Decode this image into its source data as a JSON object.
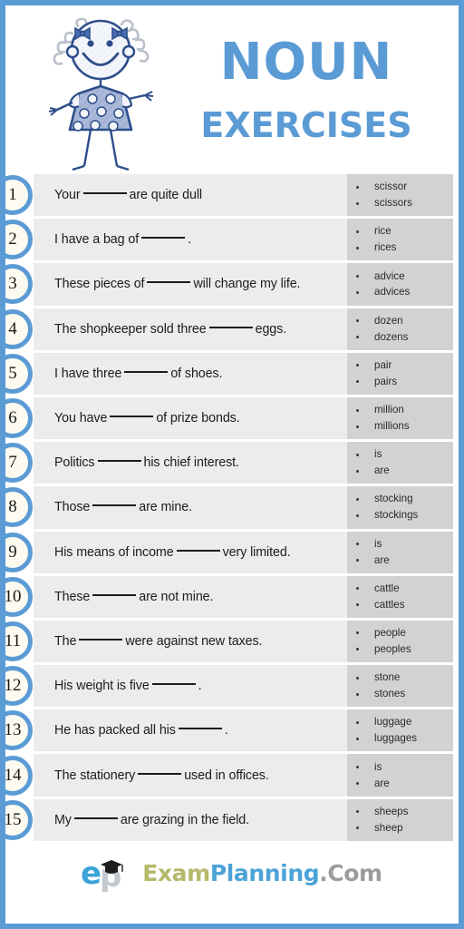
{
  "title": {
    "main": "NOUN",
    "sub": "EXERCISES"
  },
  "colors": {
    "accent_blue": "#5b9bd5",
    "border_blue": "#5b9bd5",
    "row_band": "#ececec",
    "options_box": "#d2d2d2",
    "badge_fill": "#fdfaef",
    "logo_exam": "#b5b96a",
    "logo_planning": "#4ba3d8",
    "logo_com": "#9c9c9c"
  },
  "illustration": {
    "name": "stick-figure-girl-in-polka-dot-dress"
  },
  "exercises": [
    {
      "number": "1",
      "before": "Your",
      "after": "are quite dull",
      "options": [
        "scissor",
        "scissors"
      ]
    },
    {
      "number": "2",
      "before": "I have a bag of",
      "after": ".",
      "options": [
        "rice",
        "rices"
      ]
    },
    {
      "number": "3",
      "before": "These pieces of",
      "after": "will change my life.",
      "options": [
        "advice",
        "advices"
      ]
    },
    {
      "number": "4",
      "before": "The shopkeeper sold three",
      "after": "eggs.",
      "options": [
        "dozen",
        "dozens"
      ]
    },
    {
      "number": "5",
      "before": "I have three",
      "after": "of shoes.",
      "options": [
        "pair",
        "pairs"
      ]
    },
    {
      "number": "6",
      "before": "You have",
      "after": "of prize bonds.",
      "options": [
        "million",
        "millions"
      ]
    },
    {
      "number": "7",
      "before": "Politics",
      "after": "his chief interest.",
      "options": [
        "is",
        "are"
      ]
    },
    {
      "number": "8",
      "before": "Those",
      "after": "are mine.",
      "options": [
        "stocking",
        "stockings"
      ]
    },
    {
      "number": "9",
      "before": "His means of income",
      "after": "very limited.",
      "options": [
        "is",
        "are"
      ]
    },
    {
      "number": "10",
      "before": "These",
      "after": "are not mine.",
      "options": [
        "cattle",
        "cattles"
      ]
    },
    {
      "number": "11",
      "before": "The",
      "after": "were against new taxes.",
      "options": [
        "people",
        "peoples"
      ]
    },
    {
      "number": "12",
      "before": "His weight is five",
      "after": ".",
      "options": [
        "stone",
        "stones"
      ]
    },
    {
      "number": "13",
      "before": "He has packed all his",
      "after": ".",
      "options": [
        "luggage",
        "luggages"
      ]
    },
    {
      "number": "14",
      "before": "The stationery",
      "after": "used in offices.",
      "options": [
        "is",
        "are"
      ]
    },
    {
      "number": "15",
      "before": "My",
      "after": "are grazing in the field.",
      "options": [
        "sheeps",
        "sheep"
      ]
    }
  ],
  "footer": {
    "logo_mark": "ep-graduation-cap-logo",
    "brand_exam": "Exam",
    "brand_planning": "Planning",
    "brand_com": ".Com"
  }
}
